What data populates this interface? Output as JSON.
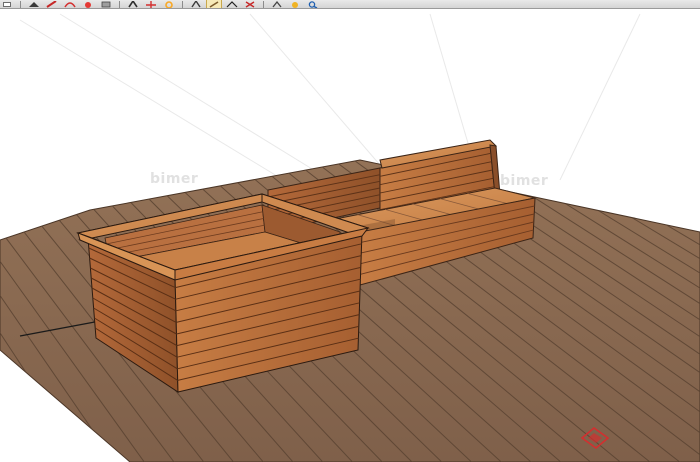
{
  "toolbar": {
    "buttons": [
      {
        "icon": "select-arrow-icon"
      },
      {
        "icon": "eraser-icon"
      },
      {
        "icon": "pencil-line-icon"
      },
      {
        "icon": "arc-icon"
      },
      {
        "icon": "paint-bucket-icon"
      },
      {
        "icon": "rectangle-icon"
      },
      {
        "icon": "push-pull-icon"
      },
      {
        "icon": "move-icon"
      },
      {
        "icon": "rotate-icon"
      },
      {
        "icon": "offset-icon"
      },
      {
        "icon": "tape-measure-icon"
      },
      {
        "icon": "text-icon"
      },
      {
        "icon": "dimension-icon"
      },
      {
        "icon": "orbit-icon"
      },
      {
        "icon": "pan-icon"
      },
      {
        "icon": "zoom-icon"
      }
    ]
  },
  "watermarks": [
    "bimer",
    "bimer"
  ],
  "colors": {
    "deck": "#8b6a4f",
    "deck_groove": "#5e4634",
    "wood": "#b26a3a",
    "wood_light": "#d38a4f",
    "wood_dark": "#7f4424",
    "edge": "#2b1a10",
    "axis": "#1a1a1a"
  }
}
